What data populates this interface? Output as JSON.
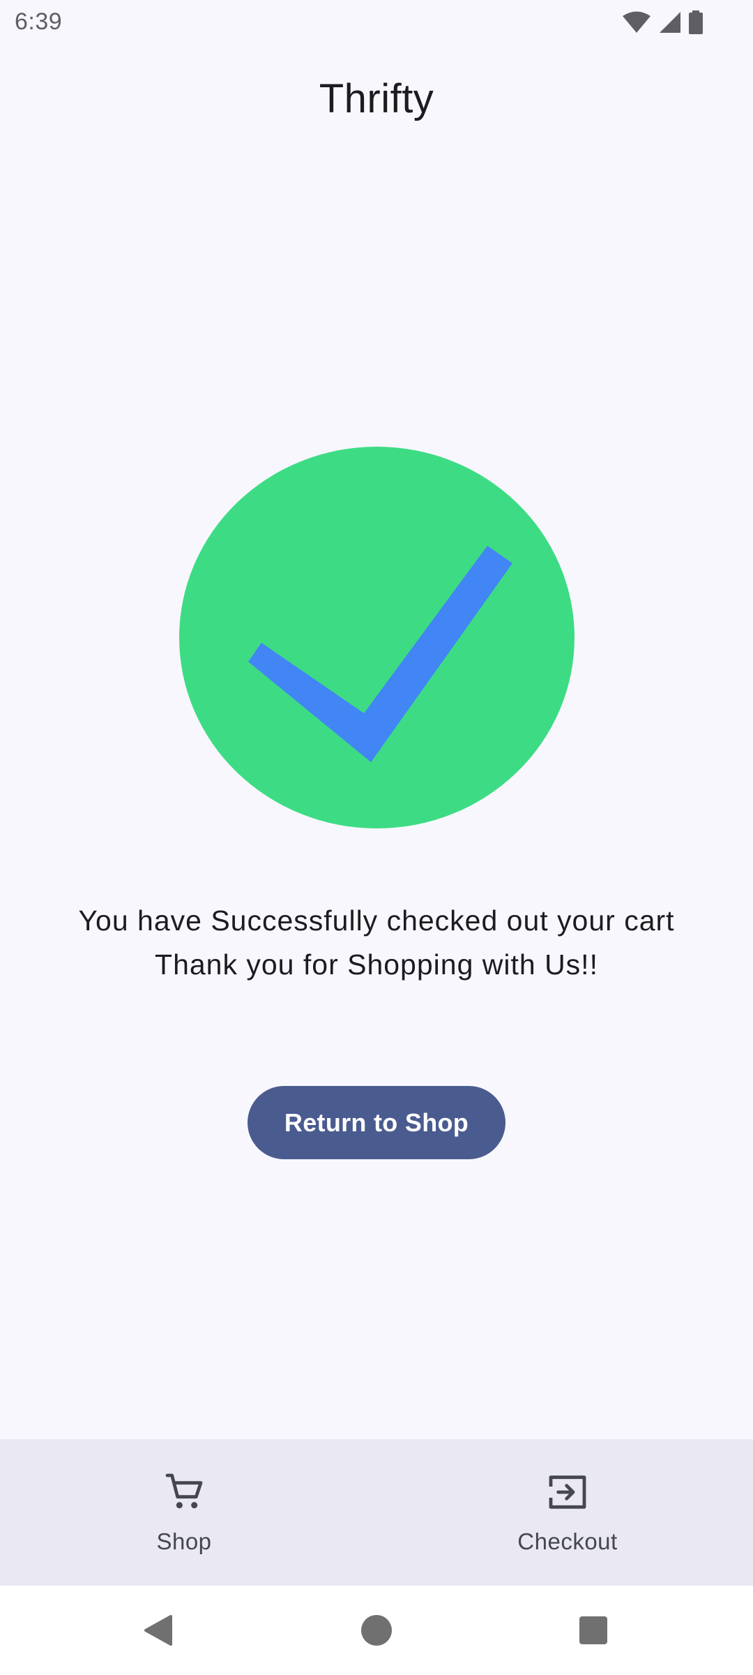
{
  "status_bar": {
    "time": "6:39",
    "icons": [
      "wifi-icon",
      "signal-icon",
      "battery-icon"
    ]
  },
  "app": {
    "title": "Thrifty"
  },
  "success": {
    "icon": "checkmark-icon",
    "circle_color": "#3ddc84",
    "check_color": "#4285f4",
    "message_line1": "You have Successfully checked out your cart",
    "message_line2": "Thank you for Shopping with Us!!"
  },
  "actions": {
    "return_label": "Return to Shop",
    "button_color": "#4a5b8f"
  },
  "bottom_nav": {
    "items": [
      {
        "label": "Shop",
        "icon": "cart-icon"
      },
      {
        "label": "Checkout",
        "icon": "exit-icon"
      }
    ]
  },
  "system_nav": {
    "buttons": [
      "back-icon",
      "home-icon",
      "recents-icon"
    ]
  }
}
